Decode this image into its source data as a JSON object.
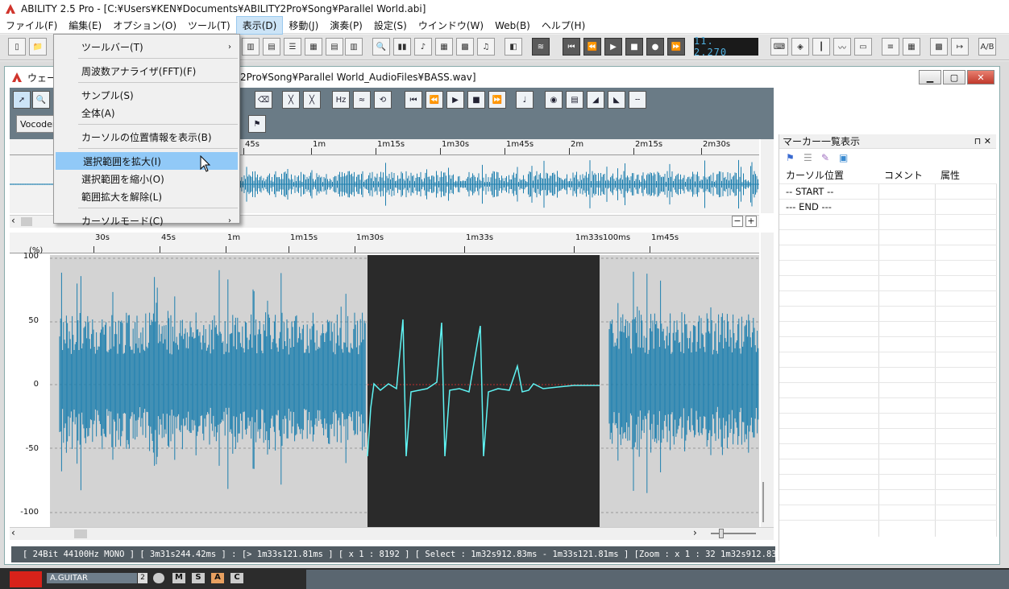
{
  "app": {
    "title": "ABILITY 2.5 Pro - [C:¥Users¥KEN¥Documents¥ABILITY2Pro¥Song¥Parallel World.abi]"
  },
  "menu": [
    "ファイル(F)",
    "編集(E)",
    "オプション(O)",
    "ツール(T)",
    "表示(D)",
    "移動(J)",
    "演奏(P)",
    "設定(S)",
    "ウインドウ(W)",
    "Web(B)",
    "ヘルプ(H)"
  ],
  "transport": {
    "time": "11. 2.270"
  },
  "dropdown": {
    "items": [
      {
        "label": "ツールバー(T)",
        "submenu": true
      },
      {
        "label": "周波数アナライザ(FFT)(F)"
      },
      {
        "label": "サンプル(S)"
      },
      {
        "label": "全体(A)"
      },
      {
        "label": "カーソルの位置情報を表示(B)"
      },
      {
        "label": "選択範囲を拡大(I)",
        "highlighted": true
      },
      {
        "label": "選択範囲を縮小(O)"
      },
      {
        "label": "範囲拡大を解除(L)"
      },
      {
        "label": "カーソルモード(C)",
        "submenu": true
      }
    ]
  },
  "wave_window": {
    "title_prefix": "ウェーブ",
    "title_path": "2Pro¥Song¥Parallel World_AudioFiles¥BASS.wav]",
    "preset": "Vocoder",
    "overview_ruler": [
      "45s",
      "1m",
      "1m15s",
      "1m30s",
      "1m45s",
      "2m",
      "2m15s",
      "2m30s"
    ],
    "main_ruler": [
      "30s",
      "45s",
      "1m",
      "1m15s",
      "1m30s",
      "1m33s",
      "1m33s100ms",
      "1m45s"
    ],
    "y_unit": "(%)",
    "y_labels": [
      "100",
      "50",
      "0",
      "-50",
      "-100"
    ],
    "status": "[ 24Bit  44100Hz  MONO ] [ 3m31s244.42ms ] : [> 1m33s121.81ms ] [ x 1 : 8192 ] [ Select : 1m32s912.83ms - 1m33s121.81ms ]  [Zoom : x 1 : 32  1m32s912.83ms - 1m33s12",
    "colors": {
      "wave": "#1e7fae",
      "selection_bg": "#2a2a2a",
      "selection_wave": "#5ff3f3",
      "bg": "#d3d3d3"
    }
  },
  "marker_panel": {
    "title": "マーカー一覧表示",
    "columns": [
      "カーソル位置",
      "コメント",
      "属性"
    ],
    "rows": [
      "-- START --",
      "--- END ---"
    ]
  },
  "track": {
    "name": "A.GUITAR",
    "number": "2",
    "buttons": [
      "M",
      "S",
      "A",
      "C"
    ]
  }
}
